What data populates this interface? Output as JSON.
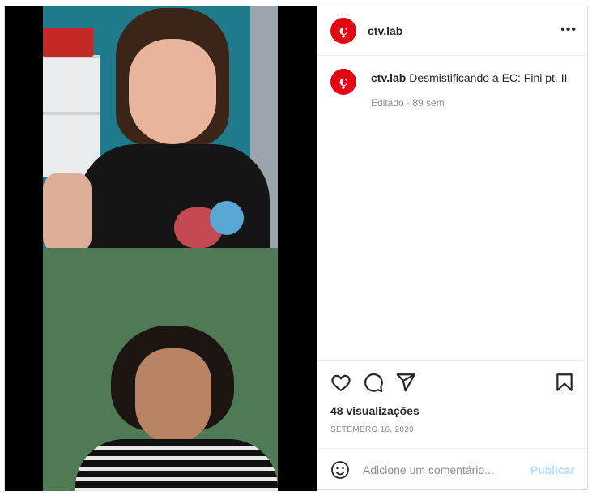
{
  "post": {
    "username": "ctv.lab",
    "avatar_letter": "ç",
    "avatar_color": "#e30613",
    "more_label": "•••",
    "caption_user": "ctv.lab",
    "caption_text": "Desmistificando a EC: Fini pt. II",
    "caption_meta": "Editado · 89 sem",
    "views": "48 visualizações",
    "date": "SETEMBRO 16, 2020"
  },
  "comment": {
    "placeholder": "Adicione um comentário...",
    "publish_label": "Publicar"
  },
  "icons": {
    "like": "heart-icon",
    "comment": "comment-icon",
    "share": "send-icon",
    "save": "bookmark-icon",
    "emoji": "smiley-icon",
    "more": "more-options-icon"
  }
}
